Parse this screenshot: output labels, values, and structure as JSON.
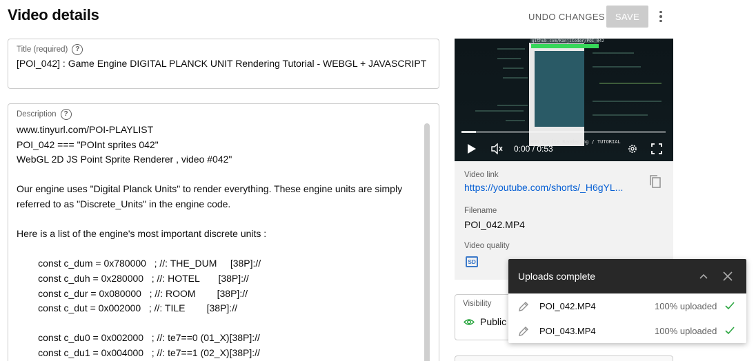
{
  "page": {
    "title": "Video details"
  },
  "toolbar": {
    "undo_label": "UNDO CHANGES",
    "save_label": "SAVE"
  },
  "title_field": {
    "label": "Title (required)",
    "value": "[POI_042] : Game Engine DIGITAL PLANCK UNIT Rendering Tutorial - WEBGL + JAVASCRIPT"
  },
  "description": {
    "label": "Description",
    "lines": [
      "www.tinyurl.com/POI-PLAYLIST",
      "POI_042 === \"POInt sprites 042\"",
      "WebGL 2D JS Point Sprite Renderer , video #042\"",
      "",
      "Our engine uses \"Digital Planck Units\" to render everything. These engine units are simply",
      "referred to as \"Discrete_Units\" in the engine code.",
      "",
      "Here is a list of the engine's most important discrete units :",
      "",
      "        const c_dum = 0x780000   ; //: THE_DUM     [38P]://",
      "        const c_duh = 0x280000   ; //: HOTEL       [38P]://",
      "        const c_dur = 0x080000   ; //: ROOM        [38P]://",
      "        const c_dut = 0x002000   ; //: TILE        [38P]://",
      "",
      "        const c_du0 = 0x002000   ; //: te7==0 (01_X)[38P]://",
      "        const c_du1 = 0x004000   ; //: te7==1 (02_X)[38P]://"
    ]
  },
  "player": {
    "time": "0:00 / 0:53",
    "progress": 0.07,
    "url_overlay": "github.com/KanjiCoder/POI_042",
    "overlay_caption": "HMO Sprite Rendering / TUTORIAL"
  },
  "video_info": {
    "link_label": "Video link",
    "link_value": "https://youtube.com/shorts/_H6gYL...",
    "filename_label": "Filename",
    "filename_value": "POI_042.MP4",
    "quality_label": "Video quality",
    "quality_badge": "SD"
  },
  "visibility": {
    "label": "Visibility",
    "value": "Public"
  },
  "uploads": {
    "title": "Uploads complete",
    "items": [
      {
        "file": "POI_042.MP4",
        "status": "100% uploaded"
      },
      {
        "file": "POI_043.MP4",
        "status": "100% uploaded"
      }
    ]
  },
  "colors": {
    "accent_link": "#065fd4",
    "success_check": "#2ba640",
    "sd_badge": "#3b79c9",
    "eye": "#2ba640"
  },
  "icons": [
    "help-icon",
    "more-vert-icon",
    "play-icon",
    "volume-icon",
    "settings-icon",
    "fullscreen-icon",
    "copy-icon",
    "sd-icon",
    "eye-icon",
    "chevron-up-icon",
    "close-icon",
    "pencil-icon",
    "check-icon"
  ]
}
